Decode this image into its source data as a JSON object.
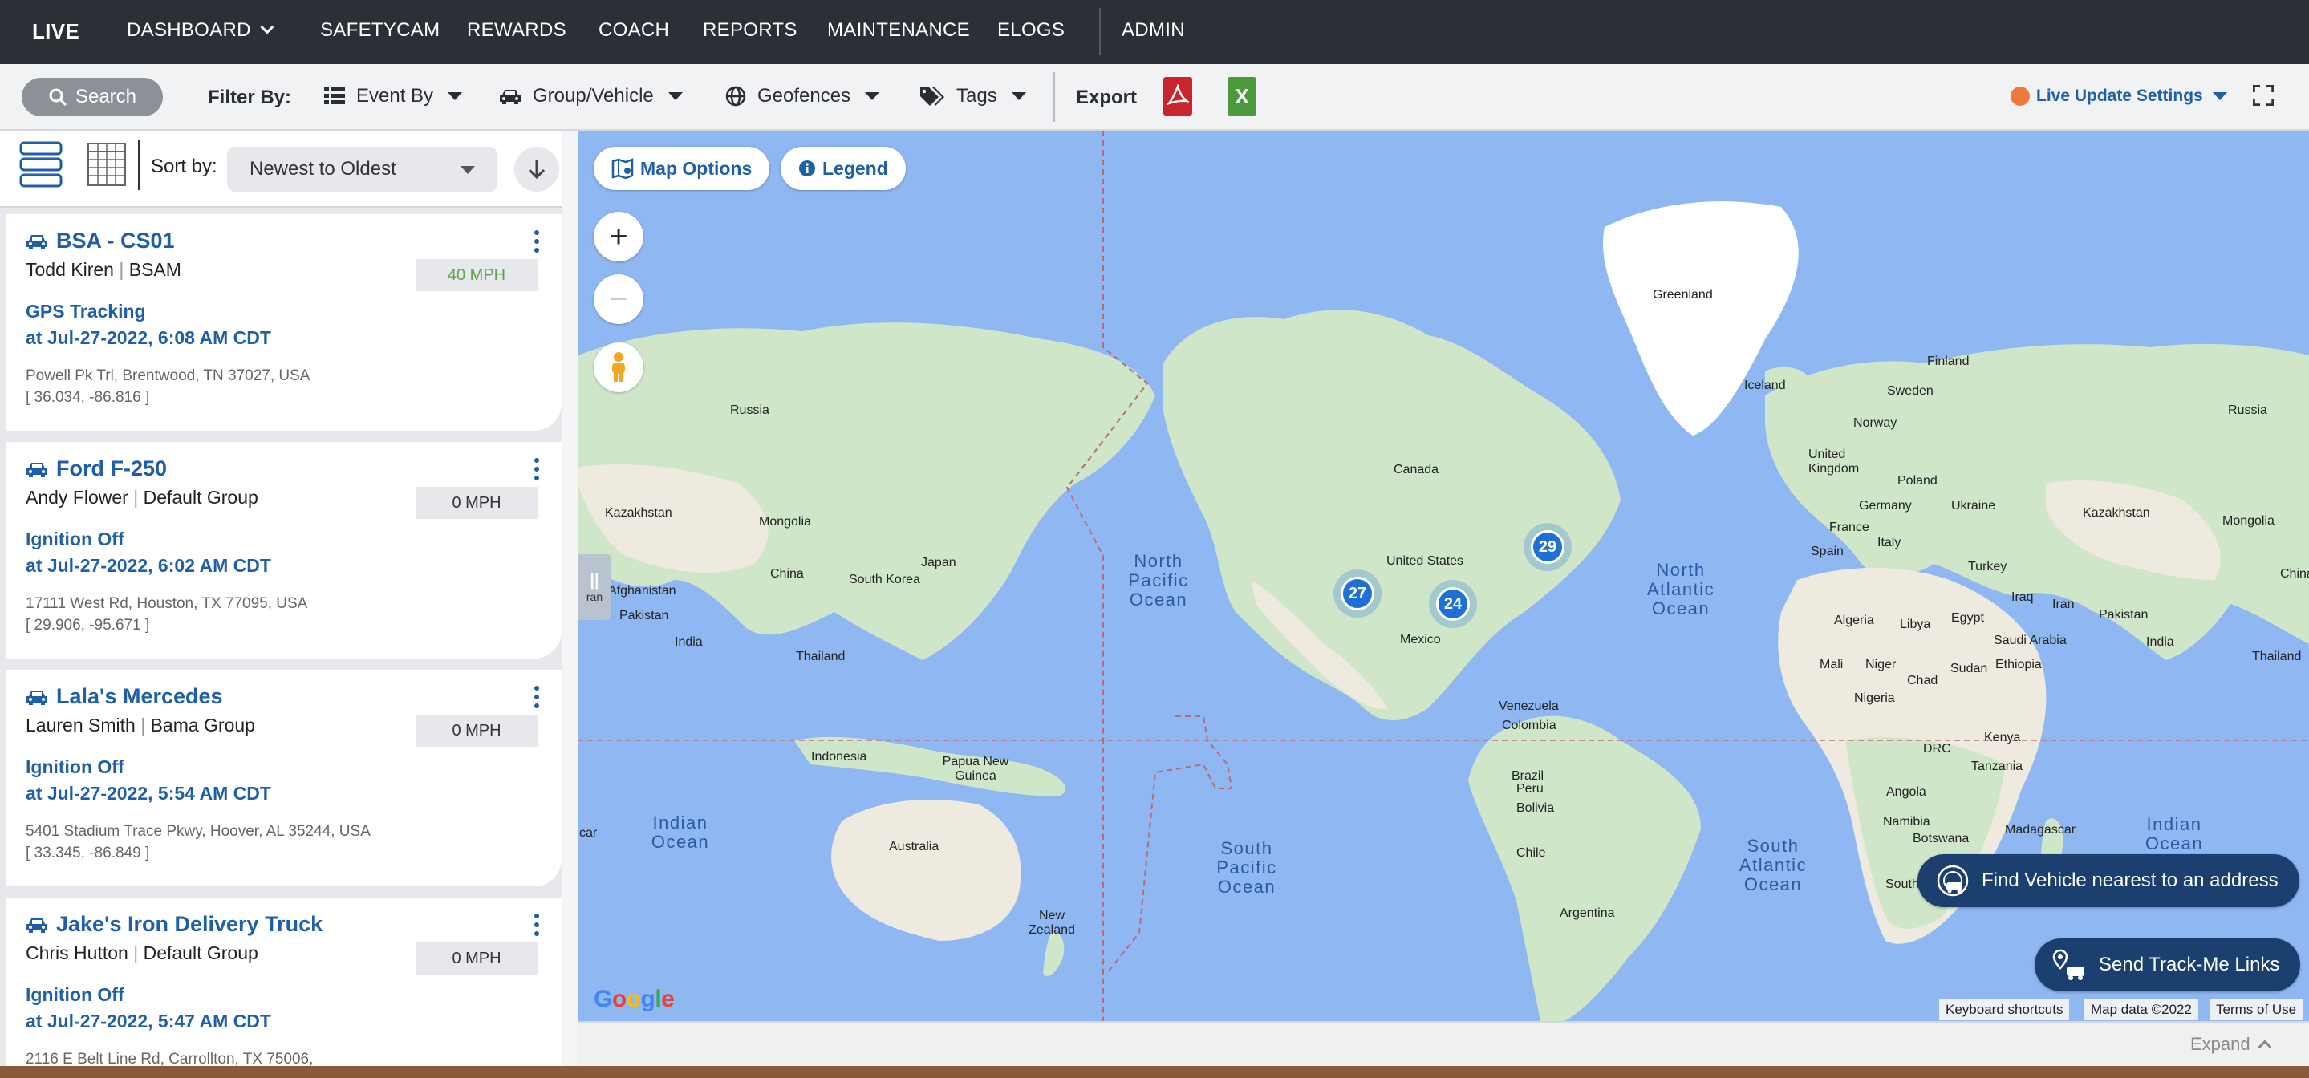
{
  "nav": {
    "brand": "LIVE",
    "items": [
      {
        "label": "DASHBOARD",
        "has_caret": true
      },
      {
        "label": "SAFETYCAM"
      },
      {
        "label": "REWARDS"
      },
      {
        "label": "COACH"
      },
      {
        "label": "REPORTS"
      },
      {
        "label": "MAINTENANCE"
      },
      {
        "label": "ELOGS"
      },
      {
        "label": "ADMIN"
      }
    ]
  },
  "filterbar": {
    "search_label": "Search",
    "filter_by_label": "Filter By:",
    "dropdowns": [
      {
        "label": "Event By",
        "icon": "list-icon"
      },
      {
        "label": "Group/Vehicle",
        "icon": "car-icon"
      },
      {
        "label": "Geofences",
        "icon": "globe-icon"
      },
      {
        "label": "Tags",
        "icon": "tag-icon"
      }
    ],
    "export_label": "Export",
    "pdf_icon": "pdf-icon",
    "excel_icon": "excel-icon",
    "live_update_label": "Live Update Settings",
    "colors": {
      "pdf": "#c8262c",
      "excel": "#4a9a3c",
      "live_dot": "#f07a3a",
      "accent": "#1f5fa8"
    }
  },
  "sort": {
    "label": "Sort by:",
    "selected": "Newest to Oldest"
  },
  "vehicles": [
    {
      "name": "BSA - CS01",
      "driver": "Todd Kiren",
      "group": "BSAM",
      "speed": "40 MPH",
      "moving": true,
      "event": "GPS Tracking",
      "time": "at Jul-27-2022, 6:08 AM CDT",
      "address": "Powell Pk Trl, Brentwood, TN 37027, USA",
      "coords": "[ 36.034, -86.816 ]"
    },
    {
      "name": "Ford F-250",
      "driver": "Andy Flower",
      "group": "Default Group",
      "speed": "0 MPH",
      "moving": false,
      "event": "Ignition Off",
      "time": "at Jul-27-2022, 6:02 AM CDT",
      "address": "17111 West Rd, Houston, TX 77095, USA",
      "coords": "[ 29.906, -95.671 ]"
    },
    {
      "name": "Lala's Mercedes",
      "driver": "Lauren Smith",
      "group": "Bama Group",
      "speed": "0 MPH",
      "moving": false,
      "event": "Ignition Off",
      "time": "at Jul-27-2022, 5:54 AM CDT",
      "address": "5401 Stadium Trace Pkwy, Hoover, AL 35244, USA",
      "coords": "[ 33.345, -86.849 ]"
    },
    {
      "name": "Jake's Iron Delivery Truck",
      "driver": "Chris Hutton",
      "group": "Default Group",
      "speed": "0 MPH",
      "moving": false,
      "event": "Ignition Off",
      "time": "at Jul-27-2022, 5:47 AM CDT",
      "address": "2116 E Belt Line Rd, Carrollton, TX 75006,",
      "coords": ""
    }
  ],
  "map": {
    "map_options_label": "Map Options",
    "legend_label": "Legend",
    "zoom_in": "+",
    "zoom_out": "−",
    "side_handle_text": "ran",
    "clusters": [
      {
        "count": "27"
      },
      {
        "count": "24"
      },
      {
        "count": "29"
      }
    ],
    "labels": {
      "greenland": "Greenland",
      "finland": "Finland",
      "russia_w": "Russia",
      "russia_e": "Russia",
      "iceland": "Iceland",
      "sweden": "Sweden",
      "norway": "Norway",
      "uk": "United Kingdom",
      "poland": "Poland",
      "germany": "Germany",
      "ukraine": "Ukraine",
      "france": "France",
      "italy": "Italy",
      "spain": "Spain",
      "turkey": "Turkey",
      "kazakhstan_e": "Kazakhstan",
      "mongolia_e": "Mongolia",
      "kazakhstan_w": "Kazakhstan",
      "mongolia_w": "Mongolia",
      "japan": "Japan",
      "china_w": "China",
      "china_e": "China",
      "south_korea": "South Korea",
      "afghanistan": "Afghanistan",
      "pakistan_w": "Pakistan",
      "india_w": "India",
      "thailand_w": "Thailand",
      "canada": "Canada",
      "united_states": "United States",
      "mexico": "Mexico",
      "iraq": "Iraq",
      "iran": "Iran",
      "pakistan_e": "Pakistan",
      "india_e": "India",
      "egypt": "Egypt",
      "saudi": "Saudi Arabia",
      "libya": "Libya",
      "algeria": "Algeria",
      "thailand_e": "Thailand",
      "mali": "Mali",
      "niger": "Niger",
      "chad": "Chad",
      "sudan": "Sudan",
      "ethiopia": "Ethiopia",
      "nigeria": "Nigeria",
      "kenya": "Kenya",
      "drc": "DRC",
      "tanzania": "Tanzania",
      "angola": "Angola",
      "namibia": "Namibia",
      "botswana": "Botswana",
      "madagascar": "Madagascar",
      "south_cut": "South",
      "venezuela": "Venezuela",
      "colombia": "Colombia",
      "brazil": "Brazil",
      "peru": "Peru",
      "bolivia": "Bolivia",
      "chile": "Chile",
      "argentina": "Argentina",
      "indonesia": "Indonesia",
      "png": "Papua New Guinea",
      "australia": "Australia",
      "new_zealand": "New Zealand",
      "car": "car"
    },
    "oceans": {
      "north_pacific": "North Pacific Ocean",
      "north_atlantic": "North Atlantic Ocean",
      "south_pacific": "South Pacific Ocean",
      "south_atlantic": "South Atlantic Ocean",
      "indian_w": "Indian Ocean",
      "indian_e": "Indian Ocean"
    },
    "find_vehicle_label": "Find Vehicle nearest to an address",
    "track_me_label": "Send Track-Me Links",
    "google_logo": "Google",
    "attribution": {
      "keyboard": "Keyboard shortcuts",
      "map_data": "Map data ©2022",
      "terms": "Terms of Use"
    },
    "colors": {
      "water": "#8fb7f2",
      "land": "#cfe6c9",
      "land_dry": "#efeadf",
      "ice": "#ffffff",
      "cluster": "#1f6fd9",
      "action_btn": "#1b3f6e"
    }
  },
  "bottom": {
    "expand_label": "Expand"
  }
}
